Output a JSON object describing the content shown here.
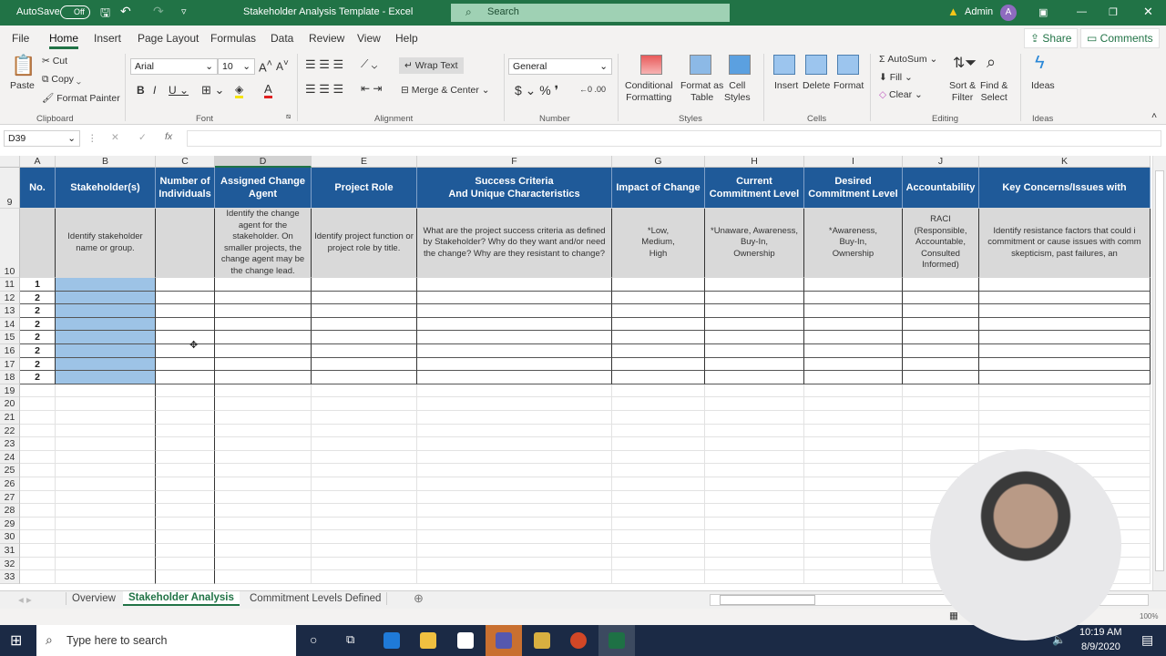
{
  "titlebar": {
    "autosave": "AutoSave",
    "autosave_state": "Off",
    "title": "Stakeholder Analysis Template  -  Excel",
    "search": "Search",
    "user": "Admin",
    "avatar": "A"
  },
  "menu": [
    "File",
    "Home",
    "Insert",
    "Page Layout",
    "Formulas",
    "Data",
    "Review",
    "View",
    "Help"
  ],
  "share": "Share",
  "comments": "Comments",
  "ribbon": {
    "clipboard": {
      "paste": "Paste",
      "cut": "Cut",
      "copy": "Copy",
      "format_painter": "Format Painter",
      "label": "Clipboard"
    },
    "font": {
      "name": "Arial",
      "size": "10",
      "label": "Font"
    },
    "alignment": {
      "wrap": "Wrap Text",
      "merge": "Merge & Center",
      "label": "Alignment"
    },
    "number": {
      "format": "General",
      "label": "Number"
    },
    "styles": {
      "conditional": "Conditional\nFormatting",
      "format_table": "Format as\nTable",
      "cell_styles": "Cell\nStyles",
      "label": "Styles"
    },
    "cells": {
      "insert": "Insert",
      "delete": "Delete",
      "format": "Format",
      "label": "Cells"
    },
    "editing": {
      "autosum": "AutoSum",
      "fill": "Fill",
      "clear": "Clear",
      "sort": "Sort &\nFilter",
      "find": "Find &\nSelect",
      "label": "Editing"
    },
    "ideas": {
      "ideas": "Ideas",
      "label": "Ideas"
    }
  },
  "namebox": "D39",
  "columns": [
    "A",
    "B",
    "C",
    "D",
    "E",
    "F",
    "G",
    "H",
    "I",
    "J",
    "K"
  ],
  "headers": [
    "No.",
    "Stakeholder(s)",
    "Number of\nIndividuals",
    "Assigned Change\nAgent",
    "Project Role",
    "Success Criteria\nAnd Unique Characteristics",
    "Impact of Change",
    "Current\nCommitment Level",
    "Desired\nCommitment Level",
    "Accountability",
    "Key Concerns/Issues with"
  ],
  "descriptions": [
    "",
    "Identify stakeholder\nname or group.",
    "",
    "Identify the change\nagent for the\nstakeholder. On\nsmaller projects, the\nchange agent may be\nthe change lead.",
    "Identify project function or\nproject role by title.",
    "What are the project success criteria as defined\nby Stakeholder? Why do they want and/or need\nthe change? Why are they resistant to change?",
    "*Low,\nMedium,\nHigh",
    "*Unaware, Awareness,\nBuy-In,\nOwnership",
    "*Awareness,\nBuy-In,\nOwnership",
    "RACI\n(Responsible,\nAccountable,\nConsulted\nInformed)",
    "Identify resistance factors that could i\ncommitment or cause issues with comm\nskepticism, past failures, an"
  ],
  "header_rows": [
    "9",
    "10"
  ],
  "data_rows": [
    {
      "row": "11",
      "no": "1"
    },
    {
      "row": "12",
      "no": "2"
    },
    {
      "row": "13",
      "no": "2"
    },
    {
      "row": "14",
      "no": "2"
    },
    {
      "row": "15",
      "no": "2"
    },
    {
      "row": "16",
      "no": "2"
    },
    {
      "row": "17",
      "no": "2"
    },
    {
      "row": "18",
      "no": "2"
    }
  ],
  "empty_rows": [
    "19",
    "20",
    "21",
    "22",
    "23",
    "24",
    "25",
    "26",
    "27",
    "28",
    "29",
    "30",
    "31",
    "32",
    "33"
  ],
  "sheets": [
    "Overview",
    "Stakeholder Analysis",
    "Commitment Levels Defined"
  ],
  "zoom": "100%",
  "taskbar": {
    "search": "Type here to search",
    "time": "10:19 AM",
    "date": "8/9/2020"
  },
  "colors": {
    "excel_green": "#217346",
    "header_blue": "#1f5a99",
    "stakeholder_fill": "#9dc3e6"
  }
}
